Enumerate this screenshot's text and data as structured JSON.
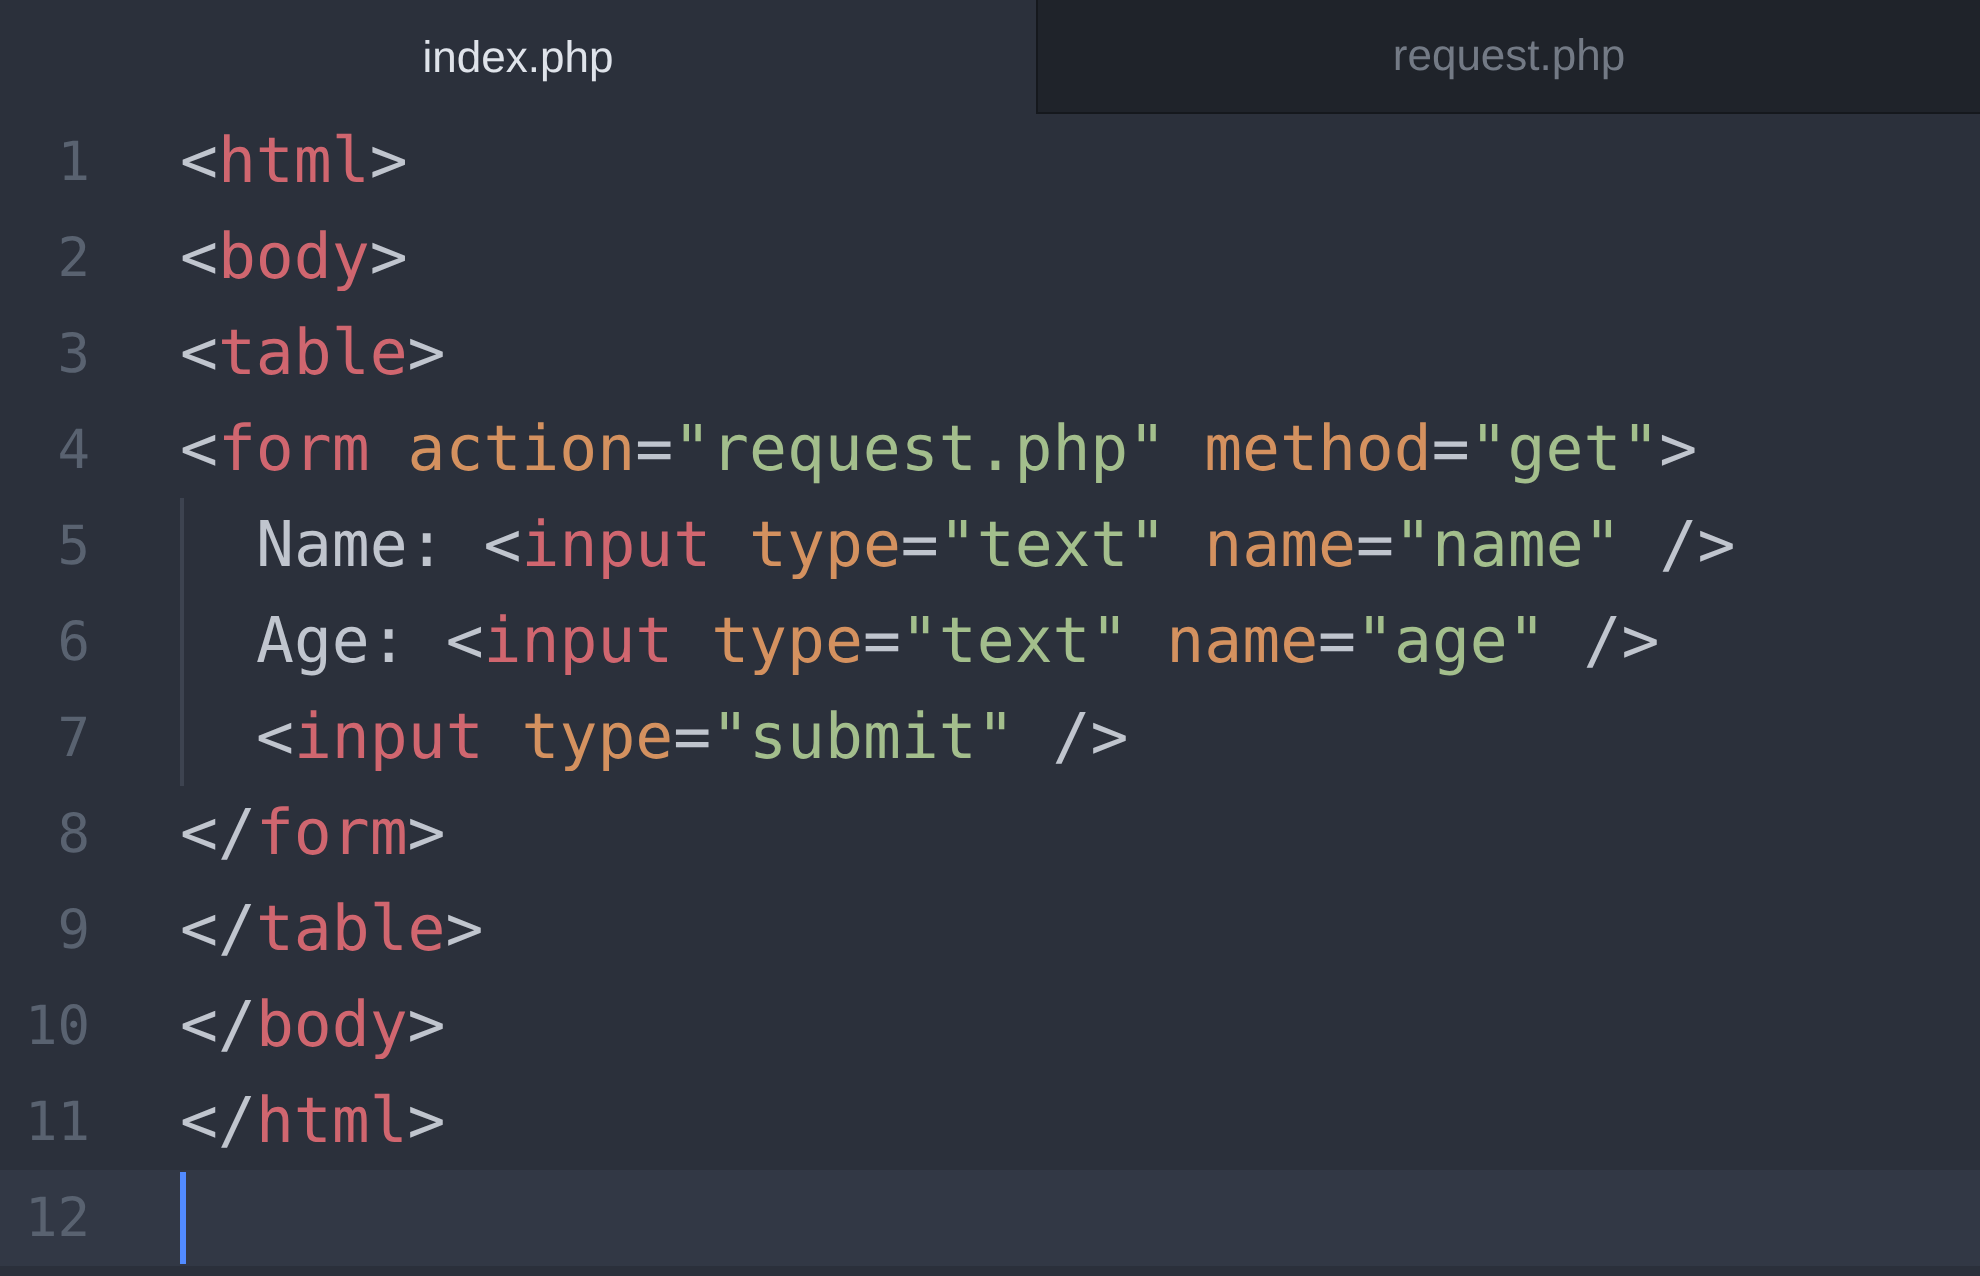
{
  "tabs": [
    {
      "label": "index.php",
      "selected": true
    },
    {
      "label": "request.php",
      "selected": false
    }
  ],
  "lines": [
    {
      "number": "1",
      "current": false,
      "tokens": [
        {
          "kind": "punct",
          "text": "<"
        },
        {
          "kind": "tag",
          "text": "html"
        },
        {
          "kind": "punct",
          "text": ">"
        }
      ]
    },
    {
      "number": "2",
      "current": false,
      "tokens": [
        {
          "kind": "punct",
          "text": "<"
        },
        {
          "kind": "tag",
          "text": "body"
        },
        {
          "kind": "punct",
          "text": ">"
        }
      ]
    },
    {
      "number": "3",
      "current": false,
      "tokens": [
        {
          "kind": "punct",
          "text": "<"
        },
        {
          "kind": "tag",
          "text": "table"
        },
        {
          "kind": "punct",
          "text": ">"
        }
      ]
    },
    {
      "number": "4",
      "current": false,
      "tokens": [
        {
          "kind": "punct",
          "text": "<"
        },
        {
          "kind": "tag",
          "text": "form"
        },
        {
          "kind": "attr",
          "text": " action"
        },
        {
          "kind": "punct",
          "text": "="
        },
        {
          "kind": "string",
          "text": "\"request.php\""
        },
        {
          "kind": "attr",
          "text": " method"
        },
        {
          "kind": "punct",
          "text": "="
        },
        {
          "kind": "string",
          "text": "\"get\""
        },
        {
          "kind": "punct",
          "text": ">"
        }
      ],
      "children": [
        {
          "number": "5",
          "current": false,
          "tokens": [
            {
              "kind": "text",
              "text": "Name: "
            },
            {
              "kind": "punct",
              "text": "<"
            },
            {
              "kind": "tag",
              "text": "input"
            },
            {
              "kind": "attr",
              "text": " type"
            },
            {
              "kind": "punct",
              "text": "="
            },
            {
              "kind": "string",
              "text": "\"text\""
            },
            {
              "kind": "attr",
              "text": " name"
            },
            {
              "kind": "punct",
              "text": "="
            },
            {
              "kind": "string",
              "text": "\"name\""
            },
            {
              "kind": "punct",
              "text": " />"
            }
          ]
        },
        {
          "number": "6",
          "current": false,
          "tokens": [
            {
              "kind": "text",
              "text": "Age: "
            },
            {
              "kind": "punct",
              "text": "<"
            },
            {
              "kind": "tag",
              "text": "input"
            },
            {
              "kind": "attr",
              "text": " type"
            },
            {
              "kind": "punct",
              "text": "="
            },
            {
              "kind": "string",
              "text": "\"text\""
            },
            {
              "kind": "attr",
              "text": " name"
            },
            {
              "kind": "punct",
              "text": "="
            },
            {
              "kind": "string",
              "text": "\"age\""
            },
            {
              "kind": "punct",
              "text": " />"
            }
          ]
        },
        {
          "number": "7",
          "current": false,
          "tokens": [
            {
              "kind": "punct",
              "text": "<"
            },
            {
              "kind": "tag",
              "text": "input"
            },
            {
              "kind": "attr",
              "text": " type"
            },
            {
              "kind": "punct",
              "text": "="
            },
            {
              "kind": "string",
              "text": "\"submit\""
            },
            {
              "kind": "punct",
              "text": " />"
            }
          ]
        }
      ]
    },
    {
      "number": "8",
      "current": false,
      "tokens": [
        {
          "kind": "punct",
          "text": "</"
        },
        {
          "kind": "tag",
          "text": "form"
        },
        {
          "kind": "punct",
          "text": ">"
        }
      ]
    },
    {
      "number": "9",
      "current": false,
      "tokens": [
        {
          "kind": "punct",
          "text": "</"
        },
        {
          "kind": "tag",
          "text": "table"
        },
        {
          "kind": "punct",
          "text": ">"
        }
      ]
    },
    {
      "number": "10",
      "current": false,
      "tokens": [
        {
          "kind": "punct",
          "text": "</"
        },
        {
          "kind": "tag",
          "text": "body"
        },
        {
          "kind": "punct",
          "text": ">"
        }
      ]
    },
    {
      "number": "11",
      "current": false,
      "tokens": [
        {
          "kind": "punct",
          "text": "</"
        },
        {
          "kind": "tag",
          "text": "html"
        },
        {
          "kind": "punct",
          "text": ">"
        }
      ]
    },
    {
      "number": "12",
      "current": true
    }
  ]
}
